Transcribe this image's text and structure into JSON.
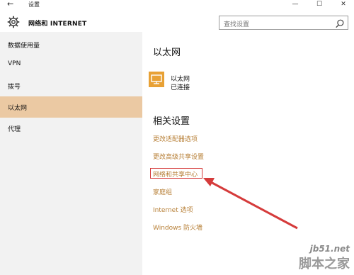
{
  "titlebar": {
    "back_icon": "back-arrow-icon",
    "title": "设置",
    "minimize": "—",
    "maximize": "☐",
    "close": "✕"
  },
  "header": {
    "icon": "gear-icon",
    "title": "网络和 INTERNET",
    "search_placeholder": "查找设置"
  },
  "sidebar": {
    "items": [
      {
        "label": "数据使用量",
        "selected": false
      },
      {
        "label": "VPN",
        "selected": false
      },
      {
        "label": "拨号",
        "selected": false
      },
      {
        "label": "以太网",
        "selected": true
      },
      {
        "label": "代理",
        "selected": false
      }
    ]
  },
  "main": {
    "heading": "以太网",
    "ethernet": {
      "name": "以太网",
      "status": "已连接",
      "icon": "monitor-network-icon"
    },
    "related_heading": "相关设置",
    "links": [
      "更改适配器选项",
      "更改高级共享设置",
      "网络和共享中心",
      "家庭组",
      "Internet 选项",
      "Windows 防火墙"
    ]
  },
  "watermark": {
    "url": "jb51.net",
    "name": "脚本之家"
  },
  "colors": {
    "accent_link": "#b77f36",
    "selected_bg": "#ebc9a3",
    "annotation": "#d53b3b",
    "ethernet_icon": "#e8a135"
  }
}
